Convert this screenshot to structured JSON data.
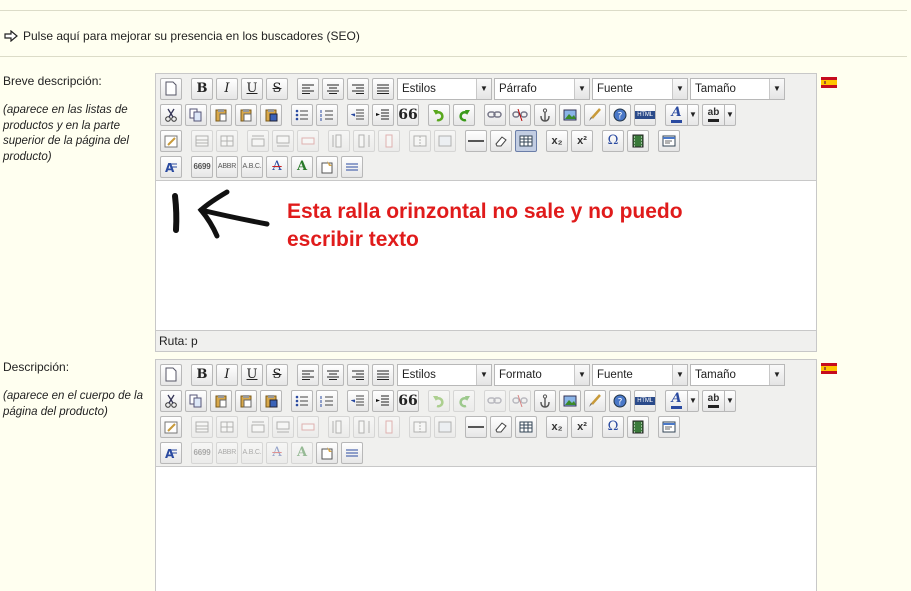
{
  "seo_link": {
    "text": "Pulse aquí para mejorar su presencia en los buscadores (SEO)"
  },
  "short_description": {
    "label": "Breve descripción:",
    "note": "(aparece en las listas de productos y en la parte superior de la página del producto)",
    "selects": {
      "styles": "Estilos",
      "format": "Párrafo",
      "font": "Fuente",
      "size": "Tamaño"
    },
    "path_label": "Ruta: p",
    "annotation": "Esta ralla orinzontal no sale y no puedo escribir texto"
  },
  "description": {
    "label": "Descripción:",
    "note": "(aparece en el cuerpo de la página del producto)",
    "selects": {
      "styles": "Estilos",
      "format": "Formato",
      "font": "Fuente",
      "size": "Tamaño"
    }
  },
  "toolbar": {
    "bold": "B",
    "italic": "I",
    "underline": "U",
    "strike": "S",
    "quote": "66",
    "html": "HTML",
    "omega": "Ω",
    "sub": "x₂",
    "sup": "x²",
    "cite": "6699",
    "abbr": "ABBR",
    "acronym": "A.B.C.",
    "font_a": "A",
    "highlight": "ab"
  },
  "colors": {
    "annotation": "#e01b1b",
    "background": "#fffff0",
    "editor_chrome": "#f0f0ee"
  },
  "language": {
    "flag_icon": "spain-flag-icon"
  }
}
